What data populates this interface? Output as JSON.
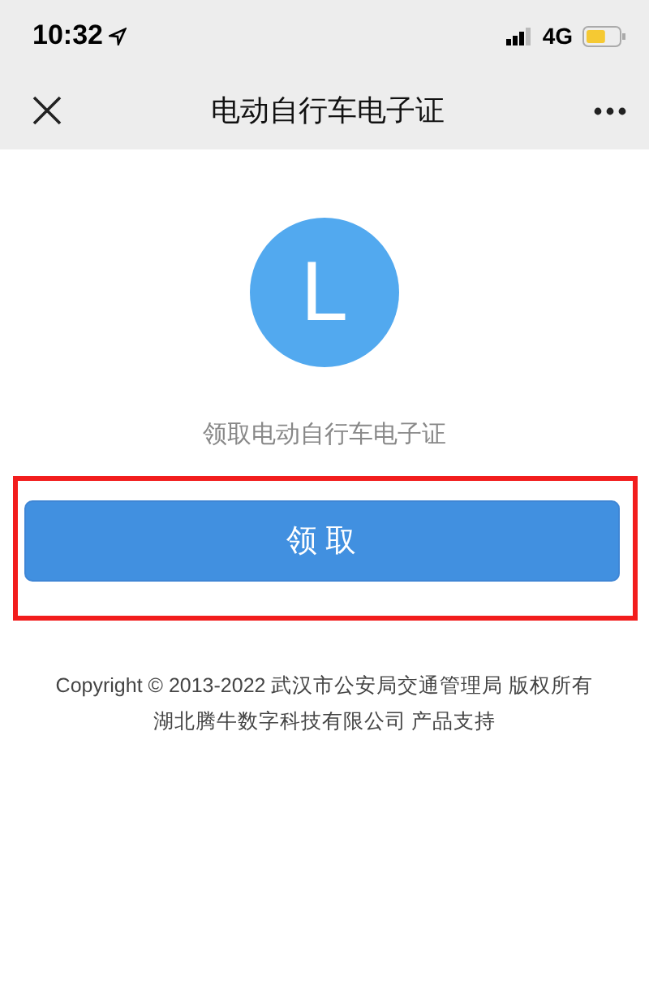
{
  "status_bar": {
    "time": "10:32",
    "network": "4G"
  },
  "nav": {
    "title": "电动自行车电子证"
  },
  "avatar": {
    "letter": "L"
  },
  "caption": "领取电动自行车电子证",
  "button": {
    "label": "领 取",
    "highlighted": true
  },
  "footer": [
    "Copyright © 2013-2022 武汉市公安局交通管理局 版权所有",
    "湖北腾牛数字科技有限公司 产品支持"
  ]
}
